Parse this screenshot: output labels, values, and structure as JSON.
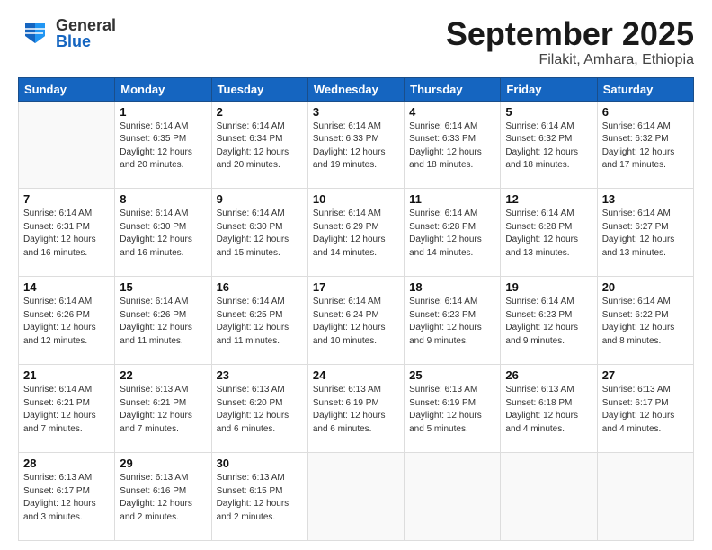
{
  "header": {
    "logo_general": "General",
    "logo_blue": "Blue",
    "title": "September 2025",
    "subtitle": "Filakit, Amhara, Ethiopia"
  },
  "weekdays": [
    "Sunday",
    "Monday",
    "Tuesday",
    "Wednesday",
    "Thursday",
    "Friday",
    "Saturday"
  ],
  "weeks": [
    [
      {
        "date": "",
        "info": ""
      },
      {
        "date": "1",
        "info": "Sunrise: 6:14 AM\nSunset: 6:35 PM\nDaylight: 12 hours\nand 20 minutes."
      },
      {
        "date": "2",
        "info": "Sunrise: 6:14 AM\nSunset: 6:34 PM\nDaylight: 12 hours\nand 20 minutes."
      },
      {
        "date": "3",
        "info": "Sunrise: 6:14 AM\nSunset: 6:33 PM\nDaylight: 12 hours\nand 19 minutes."
      },
      {
        "date": "4",
        "info": "Sunrise: 6:14 AM\nSunset: 6:33 PM\nDaylight: 12 hours\nand 18 minutes."
      },
      {
        "date": "5",
        "info": "Sunrise: 6:14 AM\nSunset: 6:32 PM\nDaylight: 12 hours\nand 18 minutes."
      },
      {
        "date": "6",
        "info": "Sunrise: 6:14 AM\nSunset: 6:32 PM\nDaylight: 12 hours\nand 17 minutes."
      }
    ],
    [
      {
        "date": "7",
        "info": "Sunrise: 6:14 AM\nSunset: 6:31 PM\nDaylight: 12 hours\nand 16 minutes."
      },
      {
        "date": "8",
        "info": "Sunrise: 6:14 AM\nSunset: 6:30 PM\nDaylight: 12 hours\nand 16 minutes."
      },
      {
        "date": "9",
        "info": "Sunrise: 6:14 AM\nSunset: 6:30 PM\nDaylight: 12 hours\nand 15 minutes."
      },
      {
        "date": "10",
        "info": "Sunrise: 6:14 AM\nSunset: 6:29 PM\nDaylight: 12 hours\nand 14 minutes."
      },
      {
        "date": "11",
        "info": "Sunrise: 6:14 AM\nSunset: 6:28 PM\nDaylight: 12 hours\nand 14 minutes."
      },
      {
        "date": "12",
        "info": "Sunrise: 6:14 AM\nSunset: 6:28 PM\nDaylight: 12 hours\nand 13 minutes."
      },
      {
        "date": "13",
        "info": "Sunrise: 6:14 AM\nSunset: 6:27 PM\nDaylight: 12 hours\nand 13 minutes."
      }
    ],
    [
      {
        "date": "14",
        "info": "Sunrise: 6:14 AM\nSunset: 6:26 PM\nDaylight: 12 hours\nand 12 minutes."
      },
      {
        "date": "15",
        "info": "Sunrise: 6:14 AM\nSunset: 6:26 PM\nDaylight: 12 hours\nand 11 minutes."
      },
      {
        "date": "16",
        "info": "Sunrise: 6:14 AM\nSunset: 6:25 PM\nDaylight: 12 hours\nand 11 minutes."
      },
      {
        "date": "17",
        "info": "Sunrise: 6:14 AM\nSunset: 6:24 PM\nDaylight: 12 hours\nand 10 minutes."
      },
      {
        "date": "18",
        "info": "Sunrise: 6:14 AM\nSunset: 6:23 PM\nDaylight: 12 hours\nand 9 minutes."
      },
      {
        "date": "19",
        "info": "Sunrise: 6:14 AM\nSunset: 6:23 PM\nDaylight: 12 hours\nand 9 minutes."
      },
      {
        "date": "20",
        "info": "Sunrise: 6:14 AM\nSunset: 6:22 PM\nDaylight: 12 hours\nand 8 minutes."
      }
    ],
    [
      {
        "date": "21",
        "info": "Sunrise: 6:14 AM\nSunset: 6:21 PM\nDaylight: 12 hours\nand 7 minutes."
      },
      {
        "date": "22",
        "info": "Sunrise: 6:13 AM\nSunset: 6:21 PM\nDaylight: 12 hours\nand 7 minutes."
      },
      {
        "date": "23",
        "info": "Sunrise: 6:13 AM\nSunset: 6:20 PM\nDaylight: 12 hours\nand 6 minutes."
      },
      {
        "date": "24",
        "info": "Sunrise: 6:13 AM\nSunset: 6:19 PM\nDaylight: 12 hours\nand 6 minutes."
      },
      {
        "date": "25",
        "info": "Sunrise: 6:13 AM\nSunset: 6:19 PM\nDaylight: 12 hours\nand 5 minutes."
      },
      {
        "date": "26",
        "info": "Sunrise: 6:13 AM\nSunset: 6:18 PM\nDaylight: 12 hours\nand 4 minutes."
      },
      {
        "date": "27",
        "info": "Sunrise: 6:13 AM\nSunset: 6:17 PM\nDaylight: 12 hours\nand 4 minutes."
      }
    ],
    [
      {
        "date": "28",
        "info": "Sunrise: 6:13 AM\nSunset: 6:17 PM\nDaylight: 12 hours\nand 3 minutes."
      },
      {
        "date": "29",
        "info": "Sunrise: 6:13 AM\nSunset: 6:16 PM\nDaylight: 12 hours\nand 2 minutes."
      },
      {
        "date": "30",
        "info": "Sunrise: 6:13 AM\nSunset: 6:15 PM\nDaylight: 12 hours\nand 2 minutes."
      },
      {
        "date": "",
        "info": ""
      },
      {
        "date": "",
        "info": ""
      },
      {
        "date": "",
        "info": ""
      },
      {
        "date": "",
        "info": ""
      }
    ]
  ]
}
